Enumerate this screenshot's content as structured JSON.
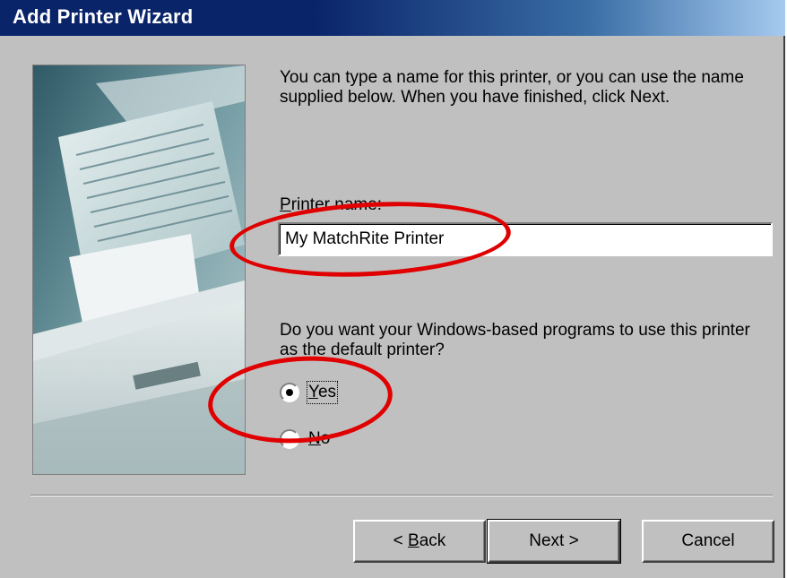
{
  "window": {
    "title": "Add Printer Wizard"
  },
  "intro_text": "You can type a name for this printer, or you can use the name supplied below. When you have finished, click Next.",
  "printer_name": {
    "label_mnemonic": "P",
    "label_rest": "rinter name:",
    "value": "My MatchRite Printer"
  },
  "default_question": "Do you want your Windows-based programs to use this printer as the default printer?",
  "radio": {
    "yes_mnemonic": "Y",
    "yes_rest": "es",
    "no_mnemonic": "N",
    "no_rest": "o",
    "selected": "yes"
  },
  "buttons": {
    "back_prefix": "< ",
    "back_mnemonic": "B",
    "back_rest": "ack",
    "next": "Next >",
    "cancel": "Cancel"
  },
  "annotation_color": "#e00000"
}
